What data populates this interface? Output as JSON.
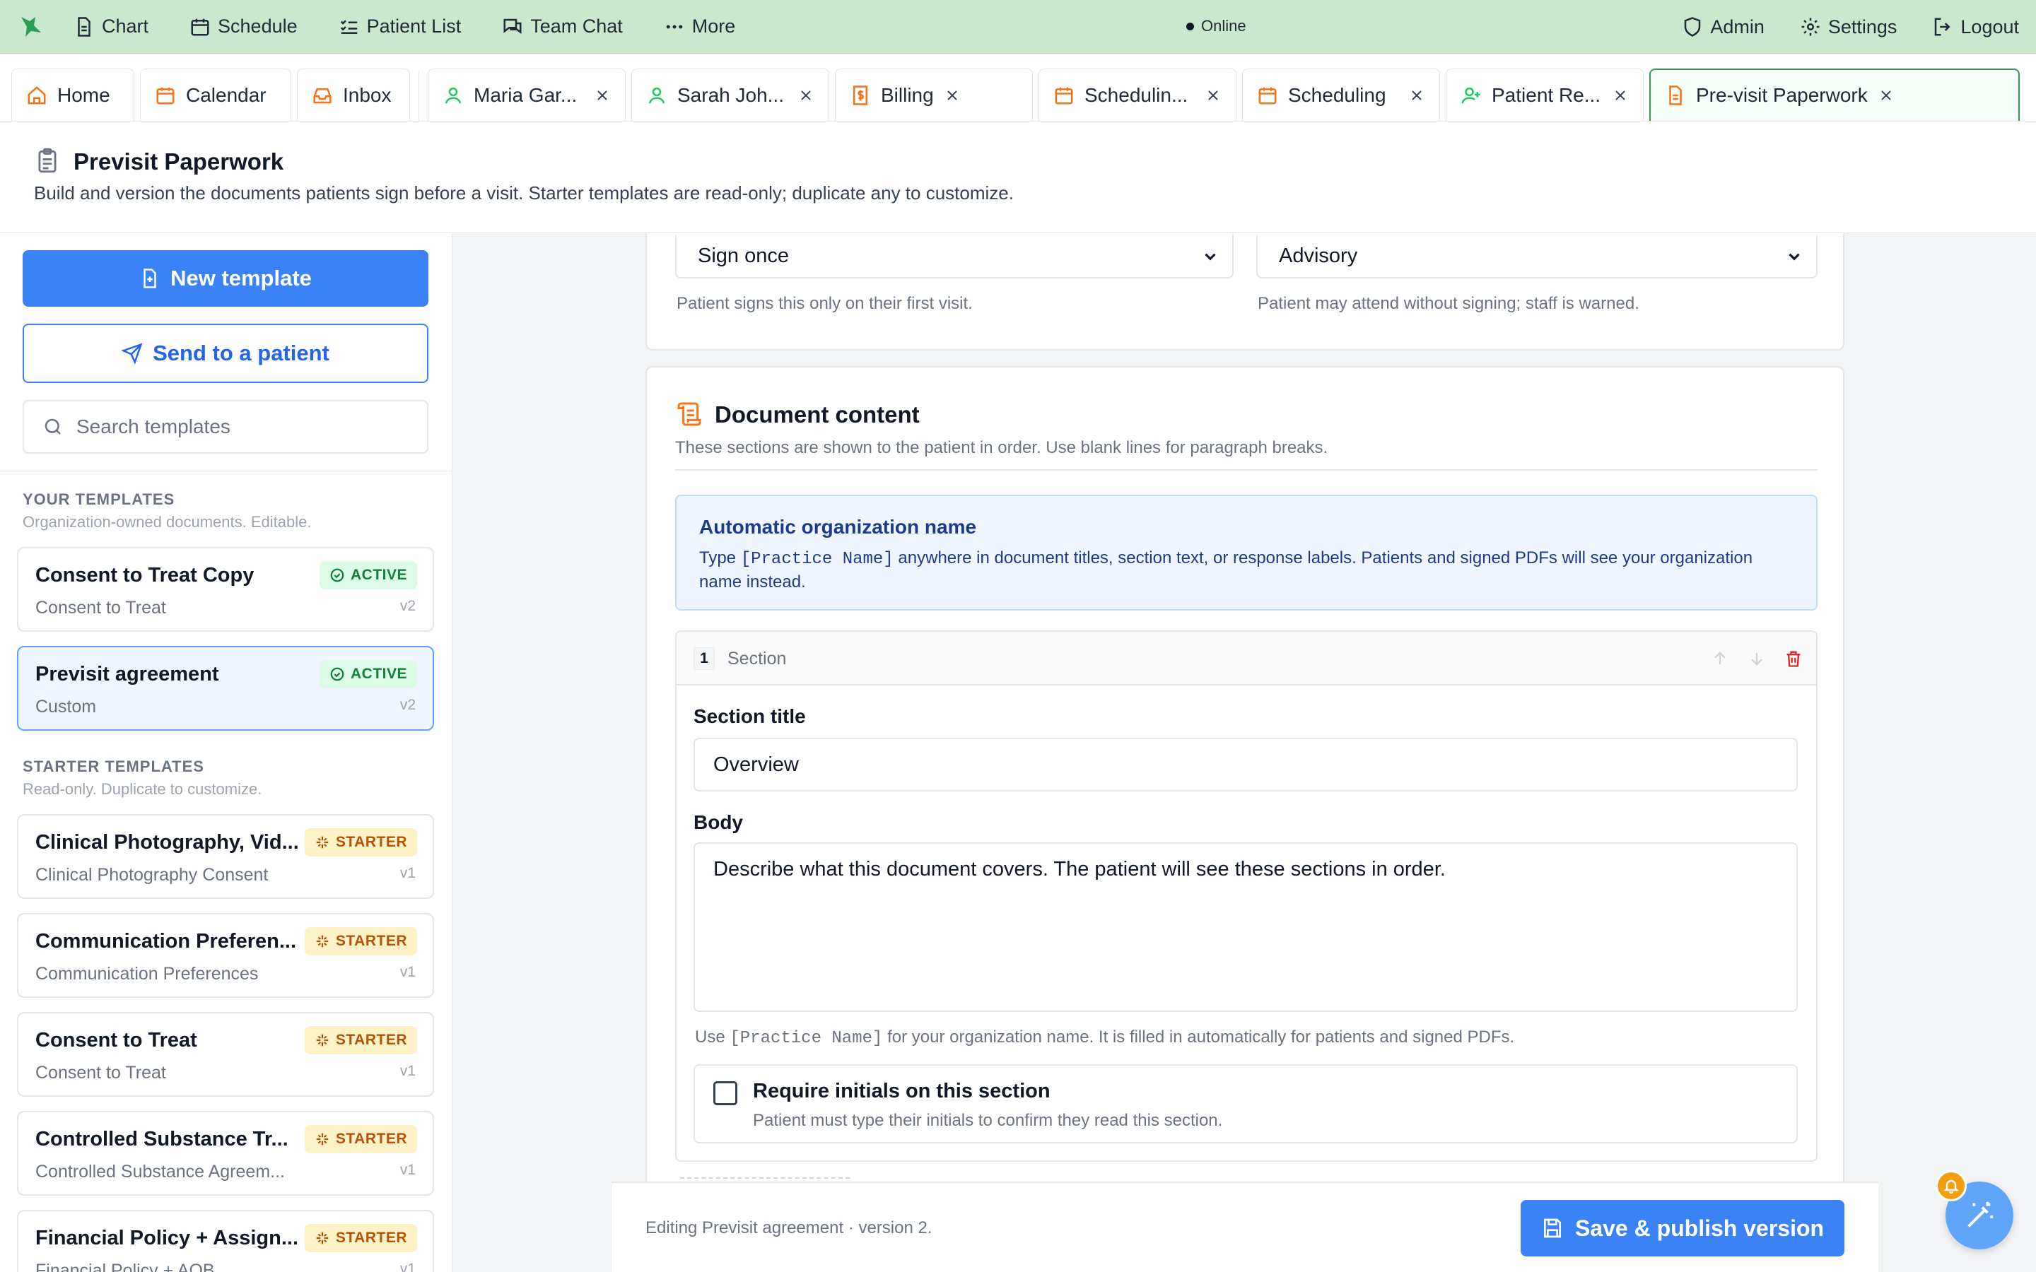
{
  "topnav": {
    "items": [
      {
        "label": "Chart",
        "icon": "document-icon"
      },
      {
        "label": "Schedule",
        "icon": "calendar-icon"
      },
      {
        "label": "Patient List",
        "icon": "list-icon"
      },
      {
        "label": "Team Chat",
        "icon": "chat-icon"
      },
      {
        "label": "More",
        "icon": "ellipsis-icon"
      }
    ],
    "status": "Online",
    "right": [
      {
        "label": "Admin",
        "icon": "shield-icon"
      },
      {
        "label": "Settings",
        "icon": "gear-icon"
      },
      {
        "label": "Logout",
        "icon": "logout-icon"
      }
    ]
  },
  "tabs": {
    "pinned": [
      {
        "label": "Home",
        "icon": "home-icon"
      },
      {
        "label": "Calendar",
        "icon": "calendar-icon"
      },
      {
        "label": "Inbox",
        "icon": "inbox-icon"
      }
    ],
    "open": [
      {
        "label": "Maria Gar...",
        "icon": "user-icon"
      },
      {
        "label": "Sarah Joh...",
        "icon": "user-icon"
      },
      {
        "label": "Billing",
        "icon": "billing-icon"
      },
      {
        "label": "Schedulin...",
        "icon": "calendar-icon"
      },
      {
        "label": "Scheduling",
        "icon": "calendar-icon"
      },
      {
        "label": "Patient Re...",
        "icon": "user-plus-icon"
      },
      {
        "label": "Pre-visit Paperwork",
        "icon": "file-icon",
        "active": true
      }
    ]
  },
  "header": {
    "title": "Previsit Paperwork",
    "subtitle": "Build and version the documents patients sign before a visit. Starter templates are read-only; duplicate any to customize."
  },
  "sidebar": {
    "new_template": "New template",
    "send_to_patient": "Send to a patient",
    "search_placeholder": "Search templates",
    "your_templates_label": "YOUR TEMPLATES",
    "your_templates_sub": "Organization-owned documents. Editable.",
    "your_templates": [
      {
        "title": "Consent to Treat Copy",
        "sub": "Consent to Treat",
        "version": "v2",
        "badge": "ACTIVE"
      },
      {
        "title": "Previsit agreement",
        "sub": "Custom",
        "version": "v2",
        "badge": "ACTIVE",
        "selected": true
      }
    ],
    "starter_label": "STARTER TEMPLATES",
    "starter_sub": "Read-only. Duplicate to customize.",
    "starter_templates": [
      {
        "title": "Clinical Photography, Vid...",
        "sub": "Clinical Photography Consent",
        "version": "v1",
        "badge": "STARTER"
      },
      {
        "title": "Communication Preferen...",
        "sub": "Communication Preferences",
        "version": "v1",
        "badge": "STARTER"
      },
      {
        "title": "Consent to Treat",
        "sub": "Consent to Treat",
        "version": "v1",
        "badge": "STARTER"
      },
      {
        "title": "Controlled Substance Tr...",
        "sub": "Controlled Substance Agreem...",
        "version": "v1",
        "badge": "STARTER"
      },
      {
        "title": "Financial Policy + Assign...",
        "sub": "Financial Policy + AOB",
        "version": "v1",
        "badge": "STARTER"
      }
    ]
  },
  "settings": {
    "frequency": "Sign once",
    "frequency_help": "Patient signs this only on their first visit.",
    "enforcement": "Advisory",
    "enforcement_help": "Patient may attend without signing; staff is warned."
  },
  "content": {
    "title": "Document content",
    "subtitle": "These sections are shown to the patient in order. Use blank lines for paragraph breaks.",
    "info_title": "Automatic organization name",
    "info_pre": "Type ",
    "info_token": "[Practice Name]",
    "info_post": " anywhere in document titles, section text, or response labels. Patients and signed PDFs will see your organization name instead.",
    "section": {
      "number": "1",
      "label": "Section",
      "title_label": "Section title",
      "title_value": "Overview",
      "body_label": "Body",
      "body_value": "Describe what this document covers. The patient will see these sections in order.",
      "hint_pre": "Use ",
      "hint_token": "[Practice Name]",
      "hint_post": " for your organization name. It is filled in automatically for patients and signed PDFs.",
      "initials_label": "Require initials on this section",
      "initials_sub": "Patient must type their initials to confirm they read this section."
    }
  },
  "footer": {
    "status": "Editing Previsit agreement · version 2.",
    "save": "Save & publish version"
  },
  "colors": {
    "accent": "#3b82f6",
    "nav_bg": "#c9e9cf",
    "active_tab": "#2e9e57",
    "starter": "#b45309",
    "active": "#15803d",
    "icon_orange": "#f97316"
  }
}
